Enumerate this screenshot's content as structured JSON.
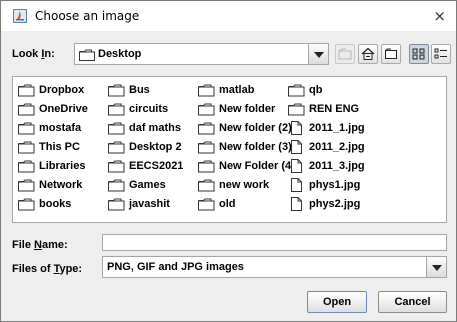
{
  "window": {
    "title": "Choose an image",
    "close_glyph": "×"
  },
  "look_in": {
    "label_prefix": "Look ",
    "label_mnemonic": "I",
    "label_suffix": "n:",
    "value": "Desktop"
  },
  "toolbar": {
    "buttons": [
      "up-one-level-icon",
      "home-icon",
      "new-folder-icon",
      "list-view-icon",
      "details-view-icon"
    ]
  },
  "files": {
    "columns": [
      [
        {
          "name": "Dropbox",
          "type": "folder"
        },
        {
          "name": "OneDrive",
          "type": "folder"
        },
        {
          "name": "mostafa",
          "type": "folder"
        },
        {
          "name": "This PC",
          "type": "folder"
        },
        {
          "name": "Libraries",
          "type": "folder"
        },
        {
          "name": "Network",
          "type": "folder"
        },
        {
          "name": "books",
          "type": "folder"
        }
      ],
      [
        {
          "name": "Bus",
          "type": "folder"
        },
        {
          "name": "circuits",
          "type": "folder"
        },
        {
          "name": "daf maths",
          "type": "folder"
        },
        {
          "name": "Desktop 2",
          "type": "folder"
        },
        {
          "name": "EECS2021",
          "type": "folder"
        },
        {
          "name": "Games",
          "type": "folder"
        },
        {
          "name": "javashit",
          "type": "folder"
        }
      ],
      [
        {
          "name": "matlab",
          "type": "folder"
        },
        {
          "name": "New folder",
          "type": "folder"
        },
        {
          "name": "New folder (2)",
          "type": "folder"
        },
        {
          "name": "New folder (3)",
          "type": "folder"
        },
        {
          "name": "New Folder (4)",
          "type": "folder"
        },
        {
          "name": "new work",
          "type": "folder"
        },
        {
          "name": "old",
          "type": "folder"
        }
      ],
      [
        {
          "name": "qb",
          "type": "folder"
        },
        {
          "name": "REN ENG",
          "type": "folder"
        },
        {
          "name": "2011_1.jpg",
          "type": "file"
        },
        {
          "name": "2011_2.jpg",
          "type": "file"
        },
        {
          "name": "2011_3.jpg",
          "type": "file"
        },
        {
          "name": "phys1.jpg",
          "type": "file"
        },
        {
          "name": "phys2.jpg",
          "type": "file"
        }
      ]
    ]
  },
  "file_name": {
    "label_prefix": "File ",
    "label_mnemonic": "N",
    "label_suffix": "ame:",
    "value": ""
  },
  "file_type": {
    "label_prefix": "Files of ",
    "label_mnemonic": "T",
    "label_suffix": "ype:",
    "value": "PNG, GIF and JPG images"
  },
  "actions": {
    "open_label": "Open",
    "cancel_label": "Cancel"
  }
}
